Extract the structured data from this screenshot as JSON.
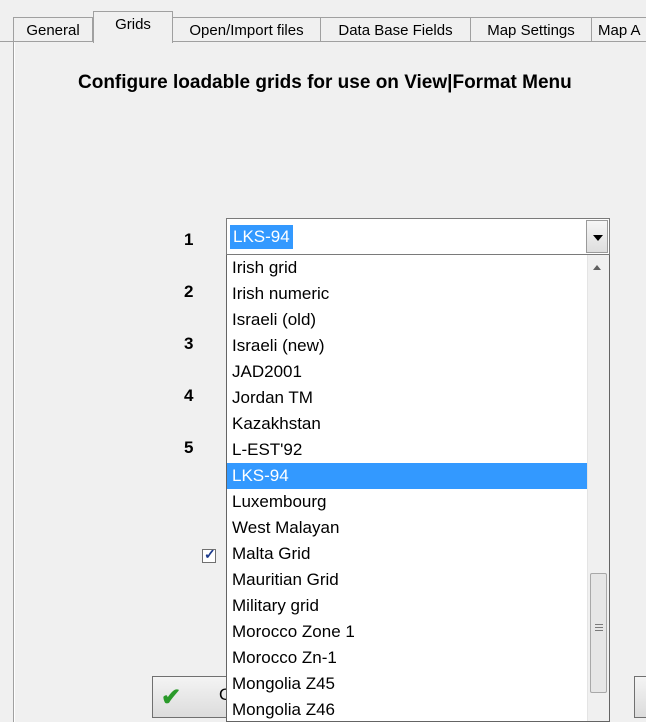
{
  "tabs": [
    {
      "label": "General"
    },
    {
      "label": "Grids"
    },
    {
      "label": "Open/Import files"
    },
    {
      "label": "Data Base Fields"
    },
    {
      "label": "Map Settings"
    },
    {
      "label": "Map A"
    }
  ],
  "active_tab": "Grids",
  "heading": "Configure loadable grids  for use on View|Format Menu",
  "row_numbers": [
    "1",
    "2",
    "3",
    "4",
    "5"
  ],
  "combo": {
    "value": "LKS-94"
  },
  "dropdown": {
    "items": [
      "Irish grid",
      "Irish numeric",
      "Israeli (old)",
      "Israeli (new)",
      "JAD2001",
      "Jordan TM",
      "Kazakhstan",
      "L-EST'92",
      "LKS-94",
      "Luxembourg",
      "West Malayan",
      "Malta Grid",
      "Mauritian Grid",
      "Military grid",
      "Morocco Zone 1",
      "Morocco Zn-1",
      "Mongolia Z45",
      "Mongolia Z46"
    ],
    "selected": "LKS-94"
  },
  "checkbox": {
    "checked": true
  },
  "ok_button": {
    "label": "O"
  },
  "colors": {
    "selection": "#3399ff",
    "ok_check": "#2a9a2a"
  }
}
